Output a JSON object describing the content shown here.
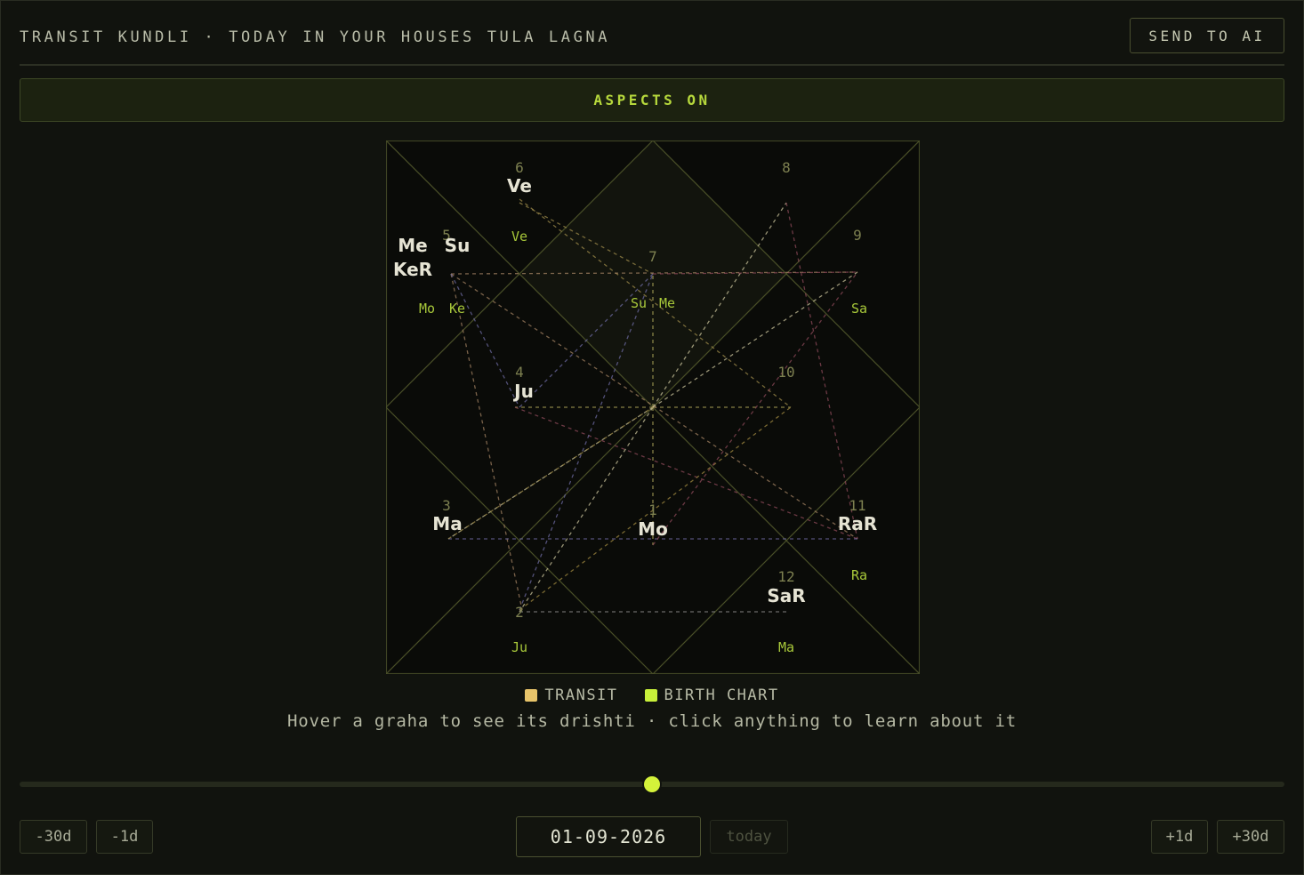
{
  "header": {
    "title": "TRANSIT KUNDLI · TODAY IN YOUR HOUSES TULA LAGNA",
    "send_label": "SEND TO AI"
  },
  "aspects_label": "ASPECTS ON",
  "chart": {
    "houses": [
      {
        "num": "1",
        "transit": [
          "Mo"
        ],
        "natal": []
      },
      {
        "num": "2",
        "transit": [],
        "natal": [
          "Ju"
        ]
      },
      {
        "num": "3",
        "transit": [
          "Ma"
        ],
        "natal": []
      },
      {
        "num": "4",
        "transit": [
          "Ju"
        ],
        "natal": []
      },
      {
        "num": "5",
        "transit": [
          "Su",
          "Me",
          "KeR"
        ],
        "natal": [
          "Mo",
          "Ke"
        ]
      },
      {
        "num": "6",
        "transit": [
          "Ve"
        ],
        "natal": [
          "Ve"
        ]
      },
      {
        "num": "7",
        "transit": [],
        "natal": [
          "Su",
          "Me"
        ]
      },
      {
        "num": "8",
        "transit": [],
        "natal": []
      },
      {
        "num": "9",
        "transit": [],
        "natal": [
          "Sa"
        ]
      },
      {
        "num": "10",
        "transit": [],
        "natal": []
      },
      {
        "num": "11",
        "transit": [
          "RaR"
        ],
        "natal": [
          "Ra"
        ]
      },
      {
        "num": "12",
        "transit": [
          "SaR"
        ],
        "natal": [
          "Ma"
        ]
      }
    ]
  },
  "legend": {
    "transit_label": "TRANSIT",
    "transit_color": "#e8c46a",
    "birth_label": "BIRTH CHART",
    "birth_color": "#c8f03a"
  },
  "hint": "Hover a graha to see its drishti · click anything to learn about it",
  "timeline": {
    "position": 0.5,
    "minus30_label": "-30d",
    "minus1_label": "-1d",
    "date": "01-09-2026",
    "today_label": "today",
    "plus1_label": "+1d",
    "plus30_label": "+30d"
  },
  "colors": {
    "accent": "#c8f03a",
    "transit_text": "#e6e4d4",
    "natal_text": "#a8c83a",
    "chart_line": "#4a5028"
  }
}
